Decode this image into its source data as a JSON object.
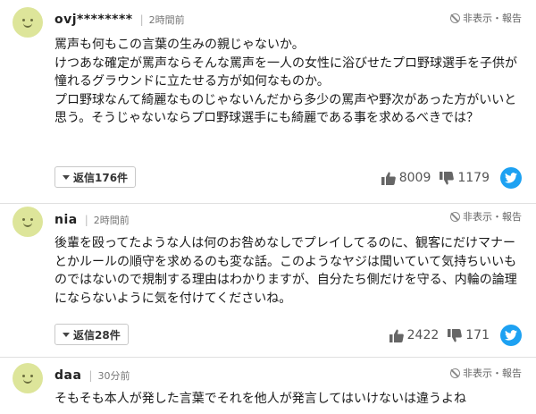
{
  "report_label": "非表示・報告",
  "comments": [
    {
      "username": "ovj********",
      "time": "2時間前",
      "body": "罵声も何もこの言葉の生みの親じゃないか。\nけつあな確定が罵声ならそんな罵声を一人の女性に浴びせたプロ野球選手を子供が憧れるグラウンドに立たせる方が如何なものか。\nプロ野球なんて綺麗なものじゃないんだから多少の罵声や野次があった方がいいと思う。そうじゃないならプロ野球選手にも綺麗である事を求めるべきでは？",
      "reply_label": "返信176件",
      "likes": "8009",
      "dislikes": "1179"
    },
    {
      "username": "nia",
      "time": "2時間前",
      "body": "後輩を殴ってたような人は何のお咎めなしでプレイしてるのに、観客にだけマナーとかルールの順守を求めるのも変な話。このようなヤジは聞いていて気持ちいいものではないので規制する理由はわかりますが、自分たち側だけを守る、内輪の論理にならないように気を付けてくださいね。",
      "reply_label": "返信28件",
      "likes": "2422",
      "dislikes": "171"
    },
    {
      "username": "daa",
      "time": "30分前",
      "body": "そもそも本人が発した言葉でそれを他人が発言してはいけないは違うよね"
    }
  ],
  "colors": {
    "avatar": "#dde59a",
    "twitter": "#1da1f2",
    "divider": "#e0e0e0"
  }
}
